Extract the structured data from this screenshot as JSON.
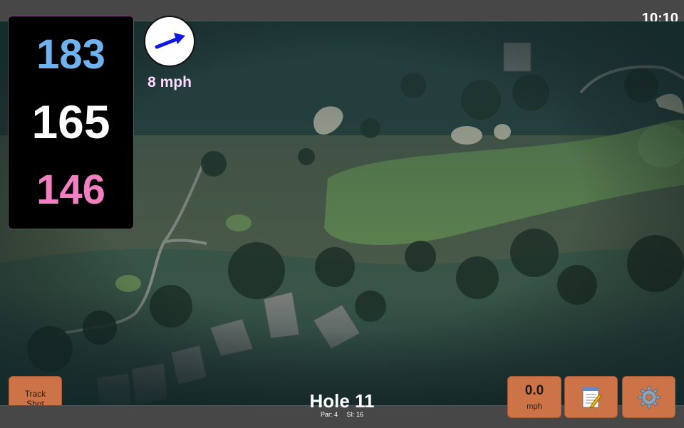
{
  "status": {
    "time": "10:10"
  },
  "distances": {
    "back": "183",
    "center": "165",
    "front": "146"
  },
  "wind": {
    "speed_label": "8 mph",
    "direction_icon": "wind-arrow-icon"
  },
  "hole": {
    "title": "Hole 11",
    "par": "Par: 4",
    "si": "SI: 16"
  },
  "controls": {
    "track_shot_label": "Track\nShot",
    "speed_value": "0.0",
    "speed_unit": "mph",
    "notes_icon": "notepad-icon",
    "settings_icon": "gear-icon"
  },
  "colors": {
    "back_distance": "#6fb2f0",
    "center_distance": "#ffffff",
    "front_distance": "#f27fc2",
    "button_orange": "#cc7448",
    "bar_accent": "#7a3d7a"
  }
}
